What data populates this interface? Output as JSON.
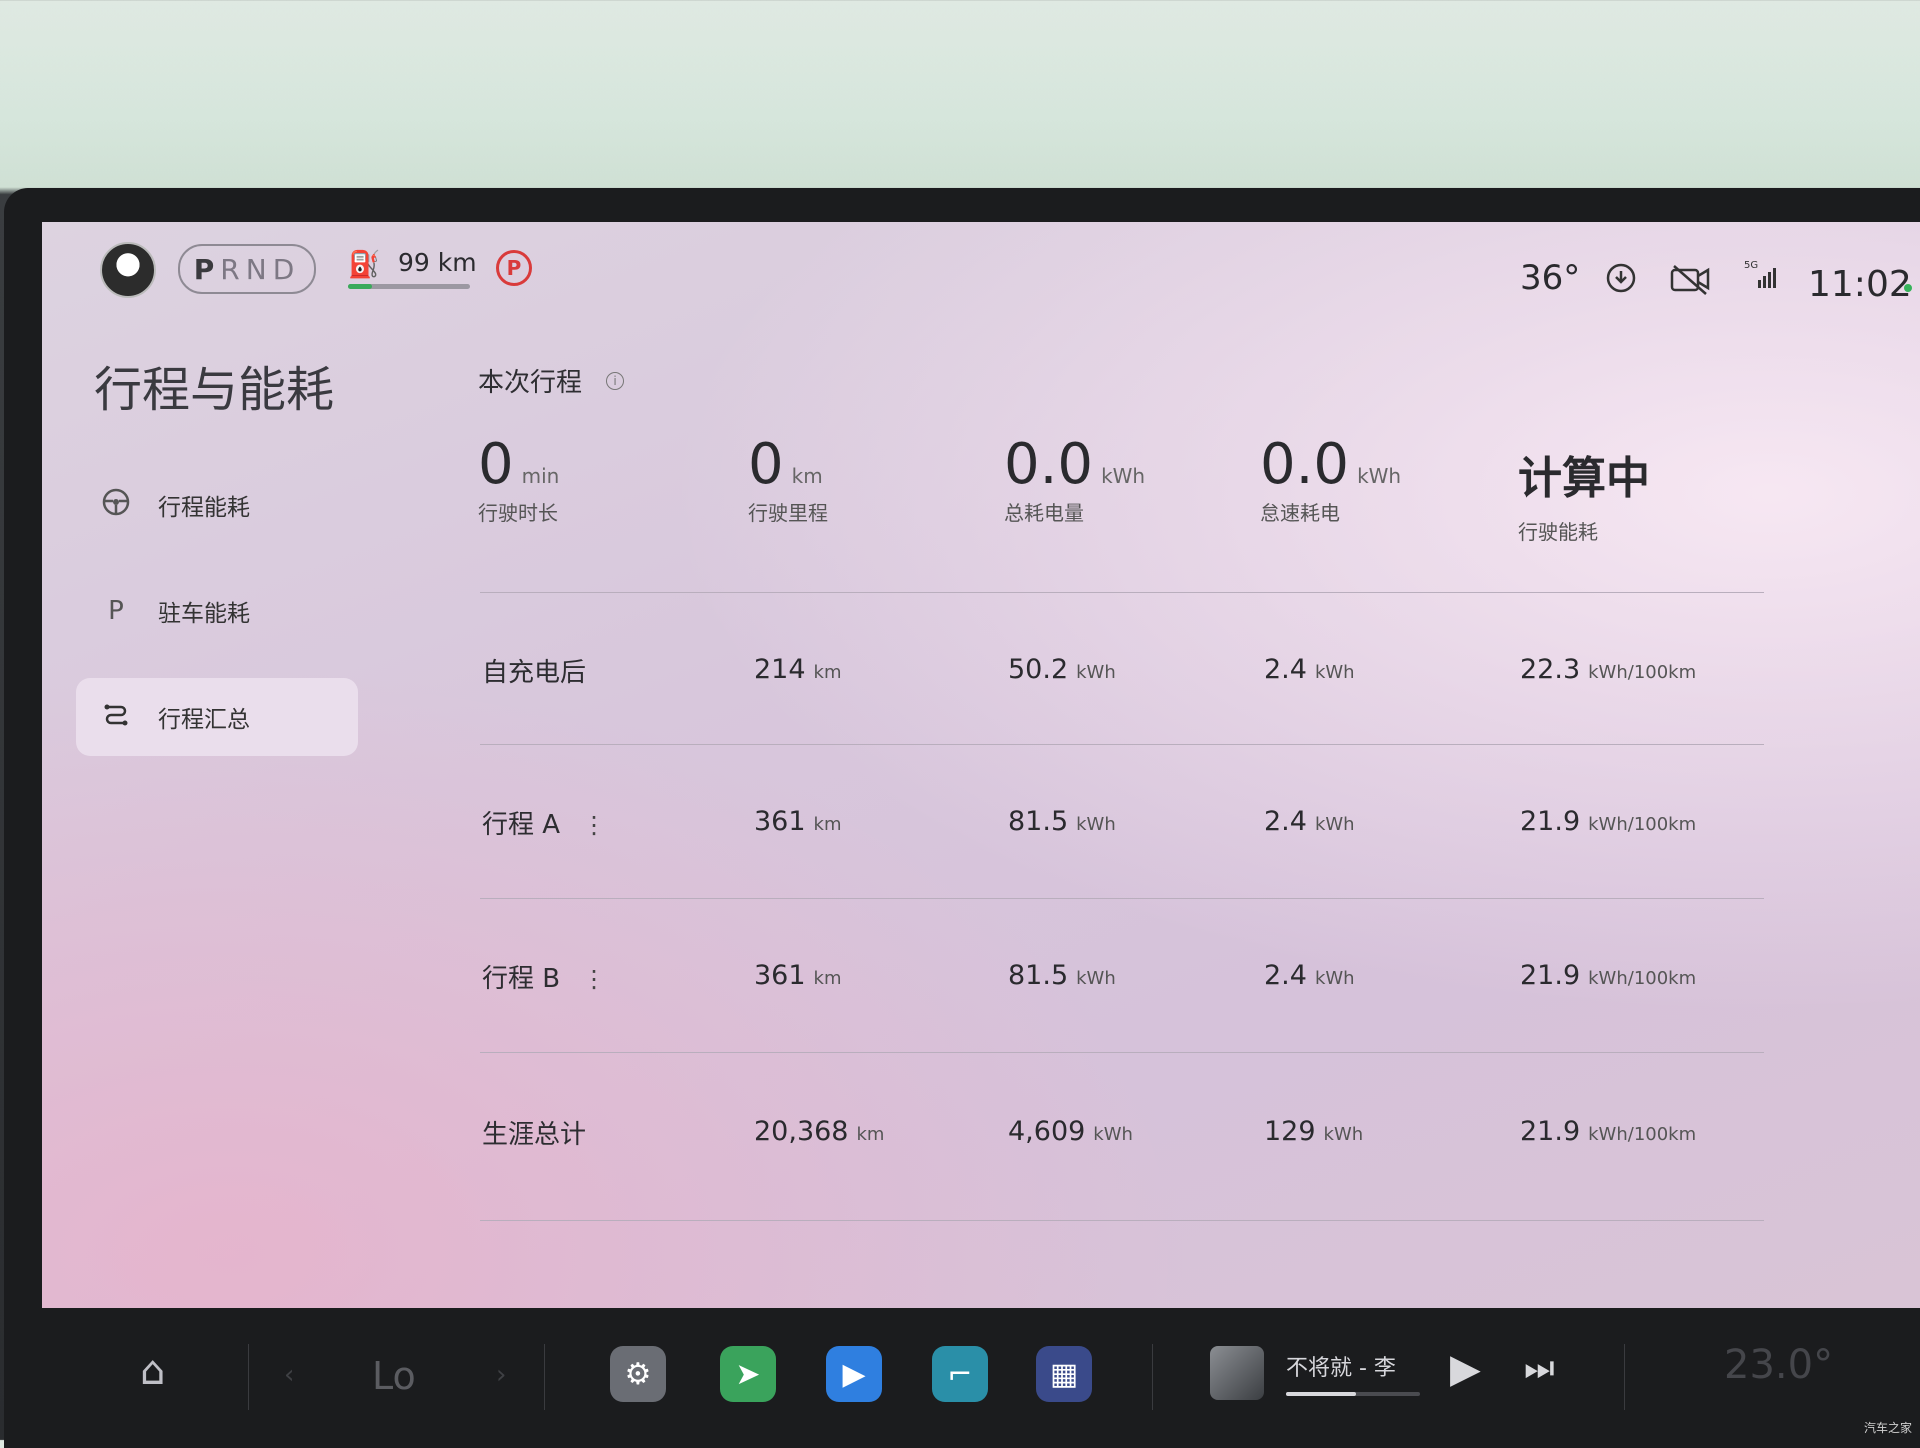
{
  "status_bar": {
    "gears": [
      "P",
      "R",
      "N",
      "D"
    ],
    "active_gear": "P",
    "range_text": "99 km",
    "range_level": 0.2,
    "park_brake_label": "P",
    "temperature": "36°",
    "time": "11:02",
    "signal_label": "5G"
  },
  "sidebar": {
    "title": "行程与能耗",
    "items": [
      {
        "label": "行程能耗",
        "icon": "steering-wheel-icon"
      },
      {
        "label": "驻车能耗",
        "icon": "parking-icon"
      },
      {
        "label": "行程汇总",
        "icon": "route-icon",
        "active": true
      }
    ],
    "parking_icon_glyph": "P"
  },
  "current_trip": {
    "title": "本次行程",
    "stats": [
      {
        "value": "0",
        "unit": "min",
        "label": "行驶时长"
      },
      {
        "value": "0",
        "unit": "km",
        "label": "行驶里程"
      },
      {
        "value": "0.0",
        "unit": "kWh",
        "label": "总耗电量"
      },
      {
        "value": "0.0",
        "unit": "kWh",
        "label": "怠速耗电"
      },
      {
        "value": "计算中",
        "unit": "",
        "label": "行驶能耗"
      }
    ]
  },
  "summary_rows": [
    {
      "label": "自充电后",
      "menu": false,
      "distance": "214",
      "distance_unit": "km",
      "energy": "50.2",
      "energy_unit": "kWh",
      "idle": "2.4",
      "idle_unit": "kWh",
      "efficiency": "22.3",
      "efficiency_unit": "kWh/100km"
    },
    {
      "label": "行程 A",
      "menu": true,
      "distance": "361",
      "distance_unit": "km",
      "energy": "81.5",
      "energy_unit": "kWh",
      "idle": "2.4",
      "idle_unit": "kWh",
      "efficiency": "21.9",
      "efficiency_unit": "kWh/100km"
    },
    {
      "label": "行程 B",
      "menu": true,
      "distance": "361",
      "distance_unit": "km",
      "energy": "81.5",
      "energy_unit": "kWh",
      "idle": "2.4",
      "idle_unit": "kWh",
      "efficiency": "21.9",
      "efficiency_unit": "kWh/100km"
    },
    {
      "label": "生涯总计",
      "menu": false,
      "distance": "20,368",
      "distance_unit": "km",
      "energy": "4,609",
      "energy_unit": "kWh",
      "idle": "129",
      "idle_unit": "kWh",
      "efficiency": "21.9",
      "efficiency_unit": "kWh/100km"
    }
  ],
  "dock": {
    "fan_label": "Lo",
    "music_title": "不将就 - 李",
    "music_progress": 0.52,
    "climate_temp": "23.0°",
    "apps": [
      {
        "name": "settings-app-icon",
        "color": "#6a6d74"
      },
      {
        "name": "navigation-app-icon",
        "color": "#3aa35c"
      },
      {
        "name": "video-call-app-icon",
        "color": "#2f7fe0"
      },
      {
        "name": "seat-app-icon",
        "color": "#2a8fa8"
      },
      {
        "name": "app-launcher-icon",
        "color": "#3a4a8a"
      }
    ]
  },
  "watermark": "汽车之家"
}
